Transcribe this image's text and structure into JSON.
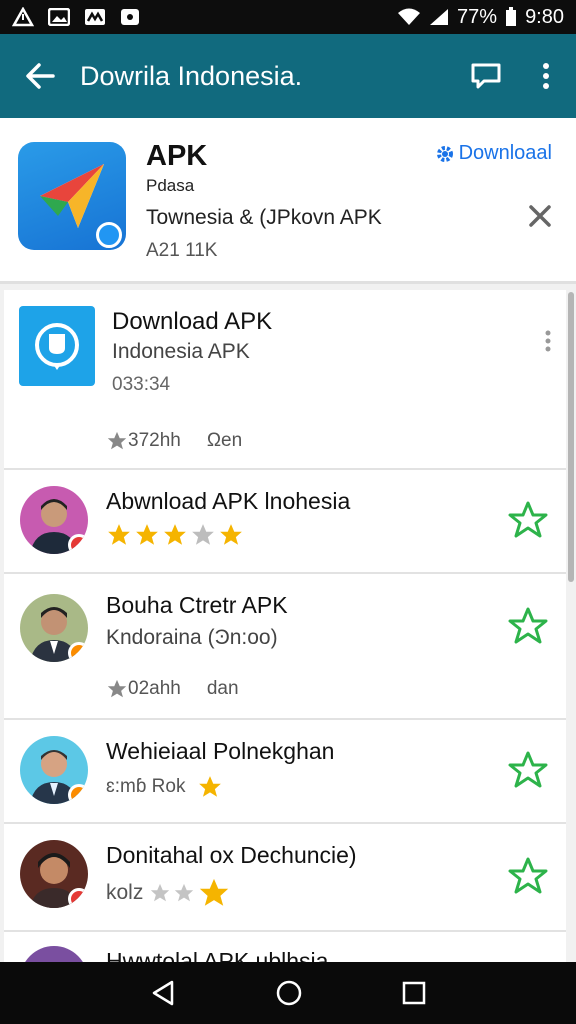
{
  "status": {
    "battery": "77%",
    "time": "9:80"
  },
  "appbar": {
    "title": "Dowrila Indonesia."
  },
  "header": {
    "title": "APK",
    "subtitle": "Pdasa",
    "description": "Townesia & (JPkovn APK",
    "size": "A21 11K",
    "download_label": "Downloaal"
  },
  "featured": {
    "title": "Download APK",
    "subtitle": "Indonesia APK",
    "time": "033:34",
    "count": "372hh",
    "tag": "Ωen"
  },
  "items": [
    {
      "title": "Abwnload APK lnohesia",
      "rating": 4.5
    },
    {
      "title": "Bouha Ctretr APK",
      "subtitle": "Kndoraina (Ͽn:oo)",
      "count": "02ahh",
      "tag": "dan"
    },
    {
      "title": "Wehieiaal Polnekghan",
      "subtitle": "ɛ:mɓ Rok"
    },
    {
      "title": "Donitahal ox Dechuncie)",
      "subtitle": "kolz"
    },
    {
      "title": "Hwwtolal APK ublhsia"
    }
  ],
  "colors": {
    "appbar": "#116a7e",
    "accent": "#1a73e8",
    "star": "#f5b400",
    "fav": "#2db34a"
  }
}
